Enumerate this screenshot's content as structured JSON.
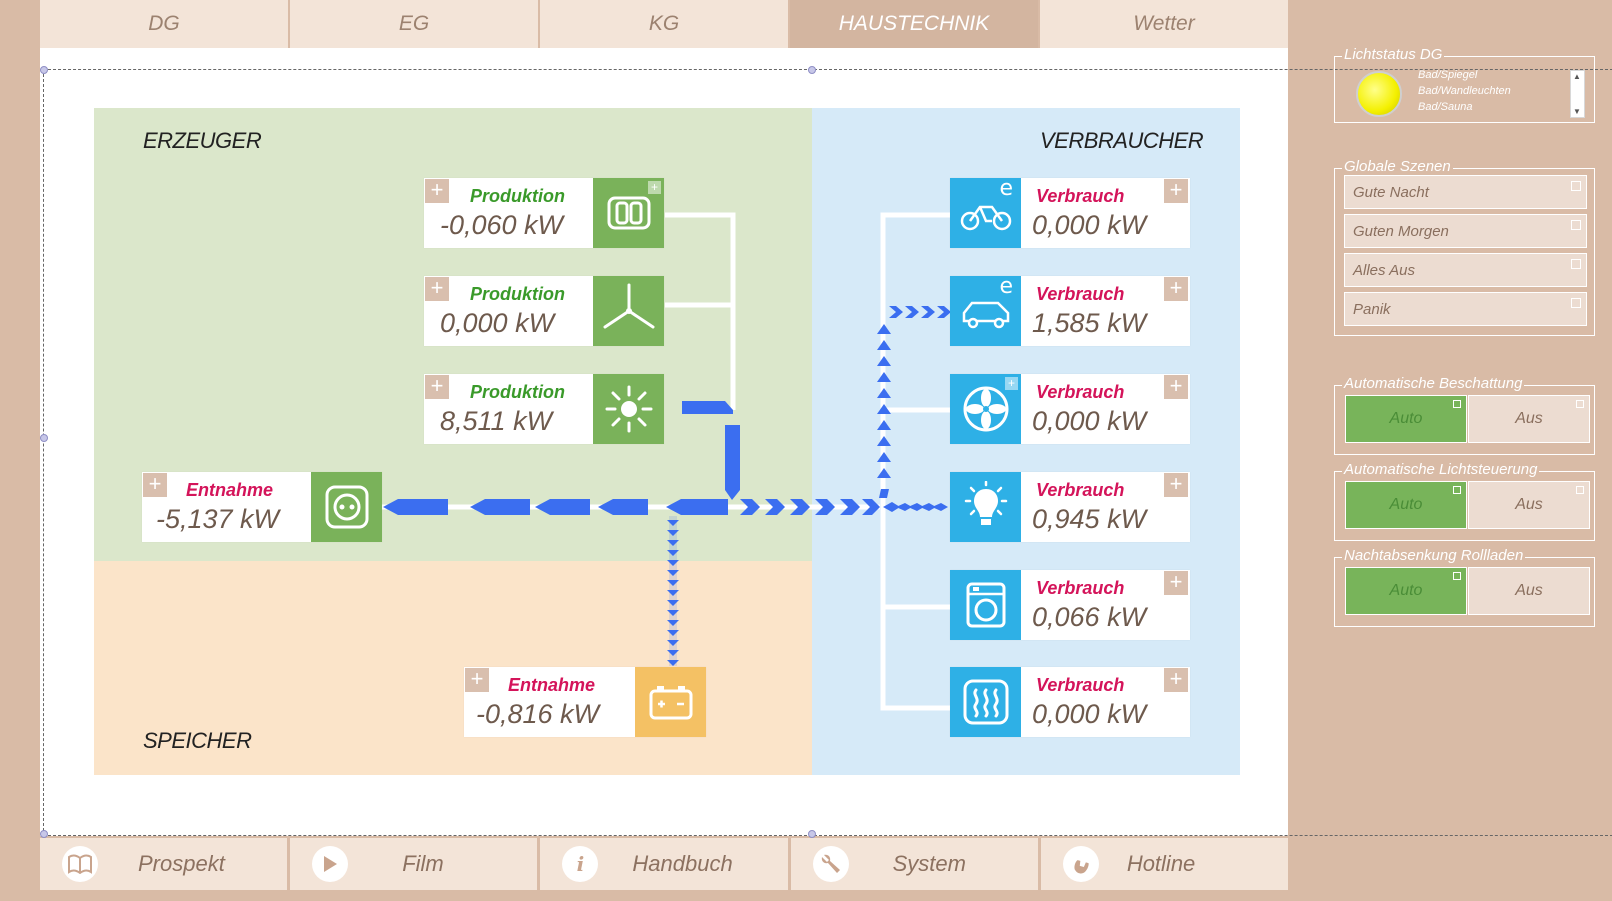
{
  "tabs": [
    "DG",
    "EG",
    "KG",
    "HAUSTECHNIK",
    "Wetter"
  ],
  "active_tab": "HAUSTECHNIK",
  "zones": {
    "erzeuger": "ERZEUGER",
    "verbraucher": "VERBRAUCHER",
    "speicher": "SPEICHER"
  },
  "producers": [
    {
      "label": "Produktion",
      "value": "-0,060 kW",
      "icon": "generator-icon"
    },
    {
      "label": "Produktion",
      "value": "0,000 kW",
      "icon": "wind-turbine-icon"
    },
    {
      "label": "Produktion",
      "value": "8,511 kW",
      "icon": "sun-icon"
    }
  ],
  "grid": {
    "label": "Entnahme",
    "value": "-5,137 kW",
    "icon": "power-socket-icon"
  },
  "storage": {
    "label": "Entnahme",
    "value": "-0,816 kW",
    "icon": "battery-icon"
  },
  "consumers": [
    {
      "label": "Verbrauch",
      "value": "0,000 kW",
      "icon": "e-bike-icon",
      "e": "e"
    },
    {
      "label": "Verbrauch",
      "value": "1,585 kW",
      "icon": "e-car-icon",
      "e": "e"
    },
    {
      "label": "Verbrauch",
      "value": "0,000 kW",
      "icon": "fan-icon",
      "e": ""
    },
    {
      "label": "Verbrauch",
      "value": "0,945 kW",
      "icon": "light-bulb-icon",
      "e": ""
    },
    {
      "label": "Verbrauch",
      "value": "0,066 kW",
      "icon": "washing-machine-icon",
      "e": ""
    },
    {
      "label": "Verbrauch",
      "value": "0,000 kW",
      "icon": "heating-icon",
      "e": ""
    }
  ],
  "bottom": [
    {
      "label": "Prospekt",
      "icon": "book-icon"
    },
    {
      "label": "Film",
      "icon": "play-icon"
    },
    {
      "label": "Handbuch",
      "icon": "info-icon"
    },
    {
      "label": "System",
      "icon": "wrench-icon"
    },
    {
      "label": "Hotline",
      "icon": "phone-icon"
    }
  ],
  "sidebar": {
    "lichtstatus": {
      "title": "Lichtstatus DG",
      "items": [
        "Bad/Spiegel",
        "Bad/Wandleuchten",
        "Bad/Sauna"
      ]
    },
    "szenen": {
      "title": "Globale Szenen",
      "items": [
        "Gute Nacht",
        "Guten Morgen",
        "Alles Aus",
        "Panik"
      ]
    },
    "beschattung": {
      "title": "Automatische Beschattung",
      "on": "Auto",
      "off": "Aus"
    },
    "lichtsteuerung": {
      "title": "Automatische Lichtsteuerung",
      "on": "Auto",
      "off": "Aus"
    },
    "rollladen": {
      "title": "Nachtabsenkung Rollladen",
      "on": "Auto",
      "off": "Aus"
    }
  },
  "colors": {
    "accent_green": "#7ab25a",
    "accent_blue": "#2eb0e6",
    "flow": "#3b6ef0",
    "consumer_text": "#d4145a",
    "producer_text": "#3a9a2a"
  }
}
